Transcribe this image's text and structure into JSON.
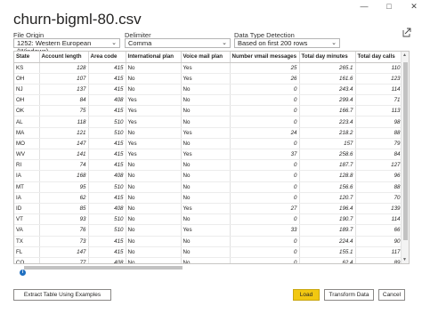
{
  "window": {
    "minimize": "—",
    "maximize": "□",
    "close": "✕"
  },
  "title": "churn-bigml-80.csv",
  "options": {
    "file_origin": {
      "label": "File Origin",
      "value": "1252: Western European (Windows)"
    },
    "delimiter": {
      "label": "Delimiter",
      "value": "Comma"
    },
    "detection": {
      "label": "Data Type Detection",
      "value": "Based on first 200 rows"
    }
  },
  "table": {
    "columns": [
      "State",
      "Account length",
      "Area code",
      "International plan",
      "Voice mail plan",
      "Number vmail messages",
      "Total day minutes",
      "Total day calls"
    ],
    "rows": [
      [
        "KS",
        "128",
        "415",
        "No",
        "Yes",
        "25",
        "265.1",
        "110"
      ],
      [
        "OH",
        "107",
        "415",
        "No",
        "Yes",
        "26",
        "161.6",
        "123"
      ],
      [
        "NJ",
        "137",
        "415",
        "No",
        "No",
        "0",
        "243.4",
        "114"
      ],
      [
        "OH",
        "84",
        "408",
        "Yes",
        "No",
        "0",
        "299.4",
        "71"
      ],
      [
        "OK",
        "75",
        "415",
        "Yes",
        "No",
        "0",
        "166.7",
        "113"
      ],
      [
        "AL",
        "118",
        "510",
        "Yes",
        "No",
        "0",
        "223.4",
        "98"
      ],
      [
        "MA",
        "121",
        "510",
        "No",
        "Yes",
        "24",
        "218.2",
        "88"
      ],
      [
        "MO",
        "147",
        "415",
        "Yes",
        "No",
        "0",
        "157",
        "79"
      ],
      [
        "WV",
        "141",
        "415",
        "Yes",
        "Yes",
        "37",
        "258.6",
        "84"
      ],
      [
        "RI",
        "74",
        "415",
        "No",
        "No",
        "0",
        "187.7",
        "127"
      ],
      [
        "IA",
        "168",
        "408",
        "No",
        "No",
        "0",
        "128.8",
        "96"
      ],
      [
        "MT",
        "95",
        "510",
        "No",
        "No",
        "0",
        "156.6",
        "88"
      ],
      [
        "IA",
        "62",
        "415",
        "No",
        "No",
        "0",
        "120.7",
        "70"
      ],
      [
        "ID",
        "85",
        "408",
        "No",
        "Yes",
        "27",
        "196.4",
        "139"
      ],
      [
        "VT",
        "93",
        "510",
        "No",
        "No",
        "0",
        "190.7",
        "114"
      ],
      [
        "VA",
        "76",
        "510",
        "No",
        "Yes",
        "33",
        "189.7",
        "66"
      ],
      [
        "TX",
        "73",
        "415",
        "No",
        "No",
        "0",
        "224.4",
        "90"
      ],
      [
        "FL",
        "147",
        "415",
        "No",
        "No",
        "0",
        "155.1",
        "117"
      ],
      [
        "CO",
        "77",
        "408",
        "No",
        "No",
        "0",
        "62.4",
        "89"
      ],
      [
        "AZ",
        "130",
        "415",
        "No",
        "No",
        "0",
        "183",
        "112"
      ]
    ]
  },
  "buttons": {
    "extract": "Extract Table Using Examples",
    "load": "Load",
    "transform": "Transform Data",
    "cancel": "Cancel"
  },
  "colors": {
    "primary_button": "#f2c811"
  },
  "icons": {
    "share": "share-icon",
    "warning": "info-icon",
    "chevron": "chevron-down-icon"
  }
}
